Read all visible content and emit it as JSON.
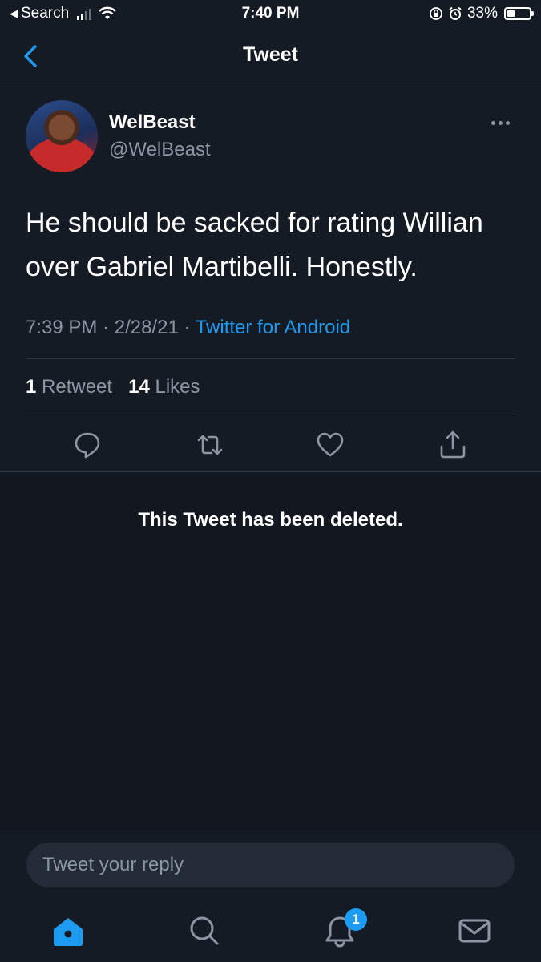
{
  "status_bar": {
    "back_app": "Search",
    "time": "7:40 PM",
    "battery": "33%",
    "battery_level": 0.33
  },
  "nav": {
    "title": "Tweet",
    "back_icon": "chevron-left-icon"
  },
  "tweet": {
    "display_name": "WelBeast",
    "handle": "@WelBeast",
    "text": "He should be sacked for rating Willian over Gabriel Martibelli. Honestly.",
    "time": "7:39 PM",
    "sep1": " · ",
    "date": "2/28/21",
    "sep2": " · ",
    "source": "Twitter for Android",
    "retweet_count": "1",
    "retweet_label": "Retweet",
    "like_count": "14",
    "like_label": "Likes"
  },
  "deleted": {
    "message": "This Tweet has been deleted."
  },
  "reply": {
    "placeholder": "Tweet your reply"
  },
  "tab_bar": {
    "notification_badge": "1"
  },
  "colors": {
    "background": "#151b24",
    "accent": "#1d9bf0",
    "secondary_text": "#8c96a3"
  }
}
